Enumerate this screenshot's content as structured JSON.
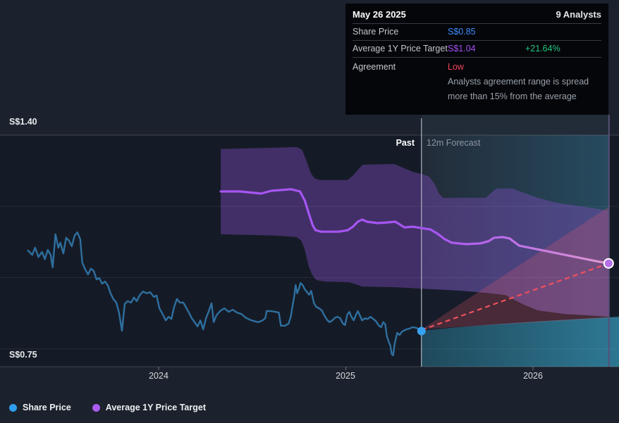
{
  "tooltip": {
    "date": "May 26 2025",
    "analysts": "9 Analysts",
    "share_price": {
      "label": "Share Price",
      "value": "S$0.85",
      "color": "#3e8eff"
    },
    "target": {
      "label": "Average 1Y Price Target",
      "value": "S$1.04",
      "change": "+21.64%",
      "value_color": "#a44ff2",
      "change_color": "#25c87d"
    },
    "agreement": {
      "label": "Agreement",
      "value": "Low",
      "value_color": "#f2455c",
      "note": "Analysts agreement range is spread more than 15% from the average"
    }
  },
  "chart": {
    "past_label": "Past",
    "forecast_label": "12m Forecast",
    "legend": [
      {
        "label": "Share Price",
        "color": "#2f9ded"
      },
      {
        "label": "Average 1Y Price Target",
        "color": "#ab5cf0"
      }
    ]
  },
  "chart_data": {
    "type": "line",
    "currency": "S$",
    "y_min": 0.75,
    "y_max": 1.4,
    "y_gridlines": [
      {
        "price": 1.4,
        "label": "S$1.40"
      },
      {
        "price": 1.2
      },
      {
        "price": 1.0
      },
      {
        "price": 0.8
      },
      {
        "price": 0.75,
        "label": "S$0.75"
      }
    ],
    "x_ticks": [
      {
        "year": 2024,
        "label": "2024"
      },
      {
        "year": 2025,
        "label": "2025"
      },
      {
        "year": 2026,
        "label": "2026"
      }
    ],
    "divider_year": 2025.404,
    "target_year": 2026.406,
    "series": [
      {
        "name": "Share Price",
        "color": "#2e6f9f",
        "dot_color": "#38a1f0",
        "points": [
          [
            2023.302,
            1.076
          ],
          [
            2023.325,
            1.064
          ],
          [
            2023.34,
            1.084
          ],
          [
            2023.358,
            1.058
          ],
          [
            2023.377,
            1.072
          ],
          [
            2023.392,
            1.052
          ],
          [
            2023.408,
            1.078
          ],
          [
            2023.423,
            1.064
          ],
          [
            2023.434,
            1.029
          ],
          [
            2023.449,
            1.122
          ],
          [
            2023.464,
            1.084
          ],
          [
            2023.475,
            1.098
          ],
          [
            2023.491,
            1.068
          ],
          [
            2023.506,
            1.112
          ],
          [
            2023.521,
            1.104
          ],
          [
            2023.536,
            1.088
          ],
          [
            2023.551,
            1.118
          ],
          [
            2023.566,
            1.127
          ],
          [
            2023.581,
            1.108
          ],
          [
            2023.592,
            1.042
          ],
          [
            2023.608,
            1.023
          ],
          [
            2023.623,
            1.009
          ],
          [
            2023.638,
            1.025
          ],
          [
            2023.653,
            1.019
          ],
          [
            2023.668,
            0.995
          ],
          [
            2023.683,
            0.999
          ],
          [
            2023.698,
            0.983
          ],
          [
            2023.713,
            0.989
          ],
          [
            2023.728,
            0.979
          ],
          [
            2023.743,
            0.956
          ],
          [
            2023.758,
            0.94
          ],
          [
            2023.774,
            0.93
          ],
          [
            2023.789,
            0.9
          ],
          [
            2023.804,
            0.851
          ],
          [
            2023.819,
            0.926
          ],
          [
            2023.834,
            0.934
          ],
          [
            2023.853,
            0.93
          ],
          [
            2023.868,
            0.944
          ],
          [
            2023.883,
            0.934
          ],
          [
            2023.898,
            0.95
          ],
          [
            2023.917,
            0.961
          ],
          [
            2023.936,
            0.956
          ],
          [
            2023.955,
            0.959
          ],
          [
            2023.974,
            0.946
          ],
          [
            2023.989,
            0.95
          ],
          [
            2024.004,
            0.914
          ],
          [
            2024.023,
            0.896
          ],
          [
            2024.038,
            0.88
          ],
          [
            2024.053,
            0.89
          ],
          [
            2024.068,
            0.884
          ],
          [
            2024.083,
            0.918
          ],
          [
            2024.098,
            0.94
          ],
          [
            2024.113,
            0.93
          ],
          [
            2024.132,
            0.93
          ],
          [
            2024.147,
            0.916
          ],
          [
            2024.162,
            0.902
          ],
          [
            2024.177,
            0.886
          ],
          [
            2024.192,
            0.875
          ],
          [
            2024.208,
            0.863
          ],
          [
            2024.223,
            0.88
          ],
          [
            2024.238,
            0.855
          ],
          [
            2024.253,
            0.886
          ],
          [
            2024.268,
            0.906
          ],
          [
            2024.283,
            0.928
          ],
          [
            2024.294,
            0.875
          ],
          [
            2024.309,
            0.894
          ],
          [
            2024.328,
            0.906
          ],
          [
            2024.351,
            0.914
          ],
          [
            2024.374,
            0.904
          ],
          [
            2024.396,
            0.91
          ],
          [
            2024.419,
            0.902
          ],
          [
            2024.442,
            0.898
          ],
          [
            2024.464,
            0.888
          ],
          [
            2024.487,
            0.882
          ],
          [
            2024.509,
            0.878
          ],
          [
            2024.532,
            0.875
          ],
          [
            2024.555,
            0.88
          ],
          [
            2024.57,
            0.886
          ],
          [
            2024.577,
            0.906
          ],
          [
            2024.6,
            0.906
          ],
          [
            2024.623,
            0.904
          ],
          [
            2024.642,
            0.902
          ],
          [
            2024.653,
            0.865
          ],
          [
            2024.675,
            0.865
          ],
          [
            2024.694,
            0.871
          ],
          [
            2024.706,
            0.89
          ],
          [
            2024.717,
            0.926
          ],
          [
            2024.725,
            0.95
          ],
          [
            2024.732,
            0.979
          ],
          [
            2024.74,
            0.956
          ],
          [
            2024.751,
            0.971
          ],
          [
            2024.758,
            0.985
          ],
          [
            2024.77,
            0.979
          ],
          [
            2024.781,
            0.967
          ],
          [
            2024.792,
            0.96
          ],
          [
            2024.804,
            0.952
          ],
          [
            2024.815,
            0.963
          ],
          [
            2024.83,
            0.928
          ],
          [
            2024.842,
            0.918
          ],
          [
            2024.857,
            0.914
          ],
          [
            2024.872,
            0.908
          ],
          [
            2024.887,
            0.892
          ],
          [
            2024.902,
            0.88
          ],
          [
            2024.913,
            0.875
          ],
          [
            2024.928,
            0.88
          ],
          [
            2024.943,
            0.888
          ],
          [
            2024.955,
            0.89
          ],
          [
            2024.97,
            0.886
          ],
          [
            2024.985,
            0.871
          ],
          [
            2024.996,
            0.867
          ],
          [
            2025.008,
            0.896
          ],
          [
            2025.019,
            0.904
          ],
          [
            2025.03,
            0.89
          ],
          [
            2025.042,
            0.88
          ],
          [
            2025.053,
            0.894
          ],
          [
            2025.064,
            0.906
          ],
          [
            2025.075,
            0.894
          ],
          [
            2025.087,
            0.88
          ],
          [
            2025.102,
            0.886
          ],
          [
            2025.117,
            0.884
          ],
          [
            2025.132,
            0.89
          ],
          [
            2025.147,
            0.884
          ],
          [
            2025.162,
            0.877
          ],
          [
            2025.177,
            0.865
          ],
          [
            2025.189,
            0.861
          ],
          [
            2025.2,
            0.875
          ],
          [
            2025.211,
            0.869
          ],
          [
            2025.219,
            0.837
          ],
          [
            2025.23,
            0.819
          ],
          [
            2025.238,
            0.809
          ],
          [
            2025.245,
            0.786
          ],
          [
            2025.253,
            0.782
          ],
          [
            2025.26,
            0.811
          ],
          [
            2025.268,
            0.831
          ],
          [
            2025.275,
            0.845
          ],
          [
            2025.287,
            0.839
          ],
          [
            2025.298,
            0.847
          ],
          [
            2025.309,
            0.851
          ],
          [
            2025.325,
            0.855
          ],
          [
            2025.34,
            0.857
          ],
          [
            2025.358,
            0.861
          ],
          [
            2025.377,
            0.859
          ],
          [
            2025.404,
            0.85
          ]
        ]
      },
      {
        "name": "Average 1Y Price Target",
        "dot_color": "#b671e9",
        "color_stops": [
          [
            "0",
            "#a655f2"
          ],
          [
            "0.55",
            "#a655f2"
          ],
          [
            "0.8",
            "#c377e3"
          ],
          [
            "1",
            "#e09ad2"
          ]
        ],
        "points": [
          [
            2024.332,
            1.242
          ],
          [
            2024.434,
            1.242
          ],
          [
            2024.509,
            1.238
          ],
          [
            2024.547,
            1.236
          ],
          [
            2024.604,
            1.244
          ],
          [
            2024.66,
            1.246
          ],
          [
            2024.709,
            1.248
          ],
          [
            2024.755,
            1.242
          ],
          [
            2024.781,
            1.216
          ],
          [
            2024.804,
            1.177
          ],
          [
            2024.823,
            1.147
          ],
          [
            2024.838,
            1.133
          ],
          [
            2024.868,
            1.129
          ],
          [
            2024.962,
            1.129
          ],
          [
            2025.011,
            1.133
          ],
          [
            2025.038,
            1.143
          ],
          [
            2025.064,
            1.157
          ],
          [
            2025.087,
            1.163
          ],
          [
            2025.113,
            1.157
          ],
          [
            2025.17,
            1.153
          ],
          [
            2025.226,
            1.155
          ],
          [
            2025.264,
            1.157
          ],
          [
            2025.283,
            1.151
          ],
          [
            2025.313,
            1.141
          ],
          [
            2025.358,
            1.143
          ],
          [
            2025.404,
            1.139
          ],
          [
            2025.453,
            1.135
          ],
          [
            2025.491,
            1.123
          ],
          [
            2025.528,
            1.108
          ],
          [
            2025.566,
            1.098
          ],
          [
            2025.642,
            1.094
          ],
          [
            2025.717,
            1.096
          ],
          [
            2025.762,
            1.102
          ],
          [
            2025.792,
            1.112
          ],
          [
            2025.838,
            1.114
          ],
          [
            2025.875,
            1.11
          ],
          [
            2025.925,
            1.09
          ],
          [
            2025.981,
            1.084
          ],
          [
            2026.057,
            1.076
          ],
          [
            2026.151,
            1.066
          ],
          [
            2026.245,
            1.056
          ],
          [
            2026.34,
            1.046
          ],
          [
            2026.404,
            1.04
          ]
        ]
      }
    ],
    "bands": {
      "past": {
        "top": [
          [
            2024.332,
            1.361
          ],
          [
            2024.642,
            1.365
          ],
          [
            2024.736,
            1.367
          ],
          [
            2024.766,
            1.359
          ],
          [
            2024.789,
            1.329
          ],
          [
            2024.811,
            1.296
          ],
          [
            2024.83,
            1.28
          ],
          [
            2024.857,
            1.274
          ],
          [
            2025.008,
            1.274
          ],
          [
            2025.038,
            1.286
          ],
          [
            2025.068,
            1.305
          ],
          [
            2025.091,
            1.317
          ],
          [
            2025.257,
            1.319
          ],
          [
            2025.294,
            1.311
          ],
          [
            2025.358,
            1.297
          ],
          [
            2025.404,
            1.291
          ]
        ],
        "bottom": [
          [
            2024.332,
            1.122
          ],
          [
            2024.623,
            1.118
          ],
          [
            2024.736,
            1.114
          ],
          [
            2024.762,
            1.104
          ],
          [
            2024.781,
            1.078
          ],
          [
            2024.8,
            1.035
          ],
          [
            2024.819,
            1.009
          ],
          [
            2024.842,
            0.993
          ],
          [
            2024.887,
            0.989
          ],
          [
            2025.019,
            0.987
          ],
          [
            2025.057,
            0.981
          ],
          [
            2025.087,
            0.975
          ],
          [
            2025.264,
            0.973
          ],
          [
            2025.34,
            0.971
          ],
          [
            2025.404,
            0.969
          ]
        ]
      },
      "forecast": {
        "top": [
          [
            2025.404,
            1.291
          ],
          [
            2025.445,
            1.284
          ],
          [
            2025.475,
            1.262
          ],
          [
            2025.498,
            1.236
          ],
          [
            2025.521,
            1.224
          ],
          [
            2025.747,
            1.224
          ],
          [
            2025.777,
            1.238
          ],
          [
            2025.804,
            1.25
          ],
          [
            2025.891,
            1.25
          ],
          [
            2025.951,
            1.238
          ],
          [
            2026.026,
            1.224
          ],
          [
            2026.132,
            1.21
          ],
          [
            2026.283,
            1.198
          ],
          [
            2026.408,
            1.188
          ]
        ],
        "bottom": [
          [
            2025.404,
            0.969
          ],
          [
            2025.491,
            0.967
          ],
          [
            2025.623,
            0.963
          ],
          [
            2025.755,
            0.957
          ],
          [
            2025.853,
            0.951
          ],
          [
            2025.898,
            0.938
          ],
          [
            2025.951,
            0.924
          ],
          [
            2026.026,
            0.908
          ],
          [
            2026.17,
            0.898
          ],
          [
            2026.302,
            0.894
          ],
          [
            2026.408,
            0.89
          ]
        ]
      }
    },
    "gap_polygon": [
      [
        2025.404,
        0.969
      ],
      [
        2025.491,
        0.967
      ],
      [
        2025.623,
        0.963
      ],
      [
        2025.755,
        0.957
      ],
      [
        2025.853,
        0.951
      ],
      [
        2025.898,
        0.938
      ],
      [
        2025.951,
        0.924
      ],
      [
        2026.026,
        0.908
      ],
      [
        2026.17,
        0.898
      ],
      [
        2026.302,
        0.894
      ],
      [
        2026.408,
        0.89
      ],
      [
        2026.408,
        0.889
      ],
      [
        2026.245,
        0.884
      ],
      [
        2026.019,
        0.877
      ],
      [
        2025.792,
        0.869
      ],
      [
        2025.566,
        0.859
      ],
      [
        2025.404,
        0.851
      ]
    ],
    "teal_area": {
      "top": [
        [
          2025.404,
          0.851
        ],
        [
          2025.566,
          0.859
        ],
        [
          2025.792,
          0.869
        ],
        [
          2026.019,
          0.877
        ],
        [
          2026.245,
          0.884
        ],
        [
          2026.464,
          0.89
        ]
      ],
      "base": 0.75
    },
    "cone": {
      "apex": [
        2025.404,
        0.855
      ],
      "top_end": [
        2026.408,
        1.2
      ],
      "bottom_end": [
        2026.408,
        0.887
      ]
    },
    "dashed": [
      [
        2025.404,
        0.853
      ],
      [
        2026.404,
        1.04
      ]
    ],
    "colors": {
      "past_bg": "#151b26",
      "forecast_bg": "#222b38",
      "band_fill": "rgba(128,76,192,0.42)",
      "gap_fill": "#161c29",
      "cone_fill": "rgba(242,92,108,0.23)",
      "teal_from": "#1f4c5f",
      "teal_to": "#2e7b97",
      "teal_overlay": "#2c7694",
      "divider_line": "#aeb6c2",
      "target_vline": "#565079",
      "dashed_line": "#f2505e",
      "grid_line": "#ffffff"
    }
  }
}
